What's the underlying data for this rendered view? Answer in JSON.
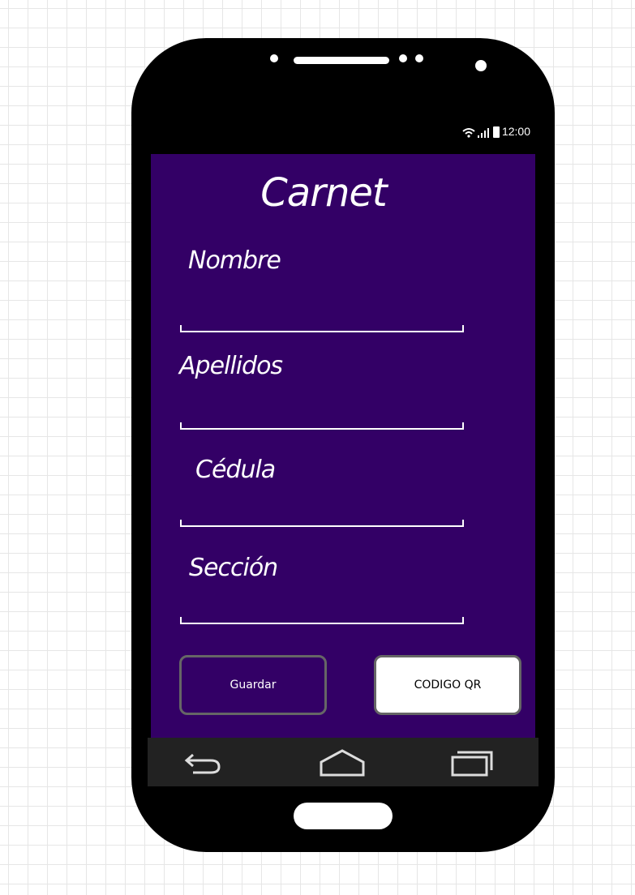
{
  "status_bar": {
    "time": "12:00"
  },
  "screen": {
    "title": "Carnet",
    "fields": [
      {
        "label": "Nombre",
        "value": ""
      },
      {
        "label": "Apellidos",
        "value": ""
      },
      {
        "label": "Cédula",
        "value": ""
      },
      {
        "label": "Sección",
        "value": ""
      }
    ],
    "buttons": {
      "save_label": "Guardar",
      "qr_label": "CODIGO QR"
    }
  },
  "nav_bar": {
    "items": [
      "back-icon",
      "home-icon",
      "recent-apps-icon"
    ]
  },
  "colors": {
    "screen_background": "#330066",
    "nav_background": "#222222",
    "device_body": "#000000"
  }
}
